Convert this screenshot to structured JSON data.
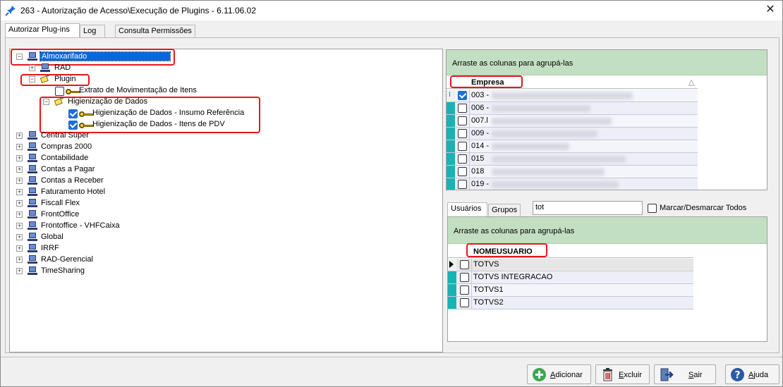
{
  "window": {
    "title": "263 - Autorização de Acesso\\Execução de Plugins - 6.11.06.02",
    "close_glyph": "✕"
  },
  "tabs": [
    {
      "label": "Autorizar Plug-ins",
      "active": true
    },
    {
      "label": "Log",
      "active": false
    },
    {
      "label": "Consulta Permissões",
      "active": false
    }
  ],
  "tree": {
    "almoxarifado": "Almoxarifado",
    "rad": "RAD",
    "plugin": "Plugin",
    "extrato": "Extrato de Movimentação de Itens",
    "higienizacao": "Higienização de Dados",
    "hig_insumo": "Higienização de Dados - Insumo Referência",
    "hig_pdv": "Higienização de Dados - Itens de PDV",
    "modules": [
      "Central Super",
      "Compras 2000",
      "Contabilidade",
      "Contas a Pagar",
      "Contas a Receber",
      "Faturamento Hotel",
      "Fiscall Flex",
      "FrontOffice",
      "Frontoffice - VHFCaixa",
      "Global",
      "IRRF",
      "RAD-Gerencial",
      "TimeSharing"
    ]
  },
  "empresas": {
    "group_hint": "Arraste as colunas para agrupá-las",
    "column": "Empresa",
    "sort_glyph": "△",
    "rows": [
      {
        "code": "003 -",
        "checked": true
      },
      {
        "code": "006 -",
        "checked": false
      },
      {
        "code": "007.l",
        "checked": false
      },
      {
        "code": "009 -",
        "checked": false
      },
      {
        "code": "014 -",
        "checked": false
      },
      {
        "code": "015",
        "checked": false
      },
      {
        "code": "018",
        "checked": false
      },
      {
        "code": "019 -",
        "checked": false
      }
    ]
  },
  "users_panel": {
    "tab_usuarios": "Usuários",
    "tab_grupos": "Grupos",
    "filter_value": "tot",
    "mark_all": "Marcar/Desmarcar Todos",
    "group_hint": "Arraste as colunas para agrupá-las",
    "column": "NOMEUSUARIO",
    "rows": [
      "TOTVS",
      "TOTVS INTEGRACAO",
      "TOTVS1",
      "TOTVS2"
    ]
  },
  "buttons": {
    "add_first": "A",
    "add_rest": "dicionar",
    "del_first": "E",
    "del_rest": "xcluir",
    "exit_first": "S",
    "exit_rest": "air",
    "help_first": "A",
    "help_rest": "juda"
  },
  "colors": {
    "accent": "#0a66e0",
    "highlight": "#e3191c",
    "group_header": "#c3dfc3",
    "row_indicator": "#1ab3b3"
  }
}
